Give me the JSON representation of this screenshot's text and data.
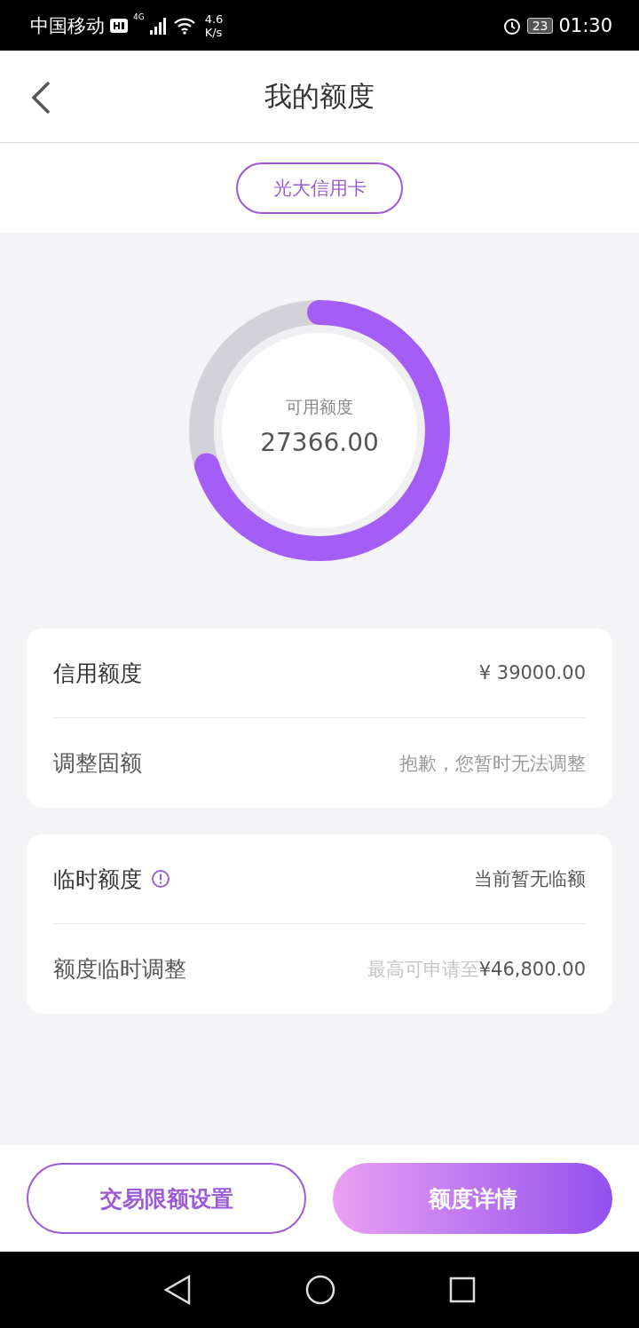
{
  "status_bar": {
    "carrier": "中国移动",
    "network": "4G",
    "speed_value": "4.6",
    "speed_unit": "K/s",
    "battery": "23",
    "time": "01:30"
  },
  "header": {
    "title": "我的额度"
  },
  "card_selector": {
    "label": "光大信用卡"
  },
  "ring": {
    "label": "可用额度",
    "amount": "27366.00",
    "level": 0.7017
  },
  "groups": [
    {
      "rows": [
        {
          "label": "信用额度",
          "value": "¥ 39000.00",
          "kind": "plain"
        },
        {
          "label": "调整固额",
          "value": "抱歉，您暂时无法调整",
          "kind": "muted"
        }
      ]
    },
    {
      "rows": [
        {
          "label": "临时额度",
          "value": "当前暂无临额",
          "kind": "info"
        },
        {
          "label": "额度临时调整",
          "hint": "最高可申请至",
          "value": "¥46,800.00",
          "kind": "hint"
        }
      ]
    }
  ],
  "buttons": [
    {
      "label": "交易限额设置",
      "kind": "outline"
    },
    {
      "label": "额度详情",
      "kind": "filled"
    }
  ]
}
